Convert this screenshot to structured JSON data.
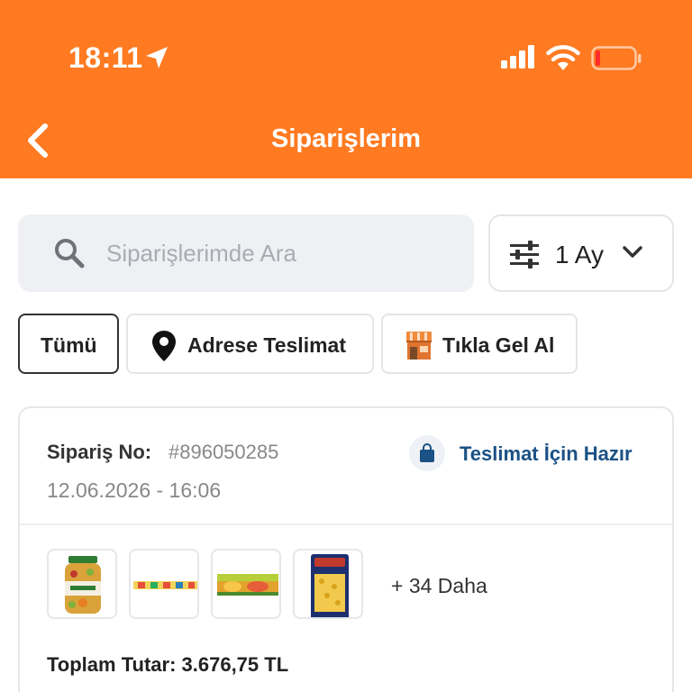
{
  "status_bar": {
    "time": "18:11"
  },
  "header": {
    "title": "Siparişlerim"
  },
  "search": {
    "placeholder": "Siparişlerimde Ara"
  },
  "period_filter": {
    "value": "1 Ay"
  },
  "filters": [
    {
      "label": "Tümü",
      "active": true
    },
    {
      "label": "Adrese Teslimat",
      "icon": "location-pin-icon"
    },
    {
      "label": "Tıkla Gel Al",
      "icon": "store-icon"
    }
  ],
  "order": {
    "number_label": "Sipariş No:",
    "number": "#896050285",
    "date": "12.06.2026 - 16:06",
    "status": "Teslimat İçin Hazır",
    "status_icon": "shopping-bag-icon",
    "more_items": "+ 34 Daha",
    "total": "Toplam Tutar: 3.676,75 TL"
  },
  "colors": {
    "brand": "#ff7a21",
    "status": "#1b5185"
  }
}
